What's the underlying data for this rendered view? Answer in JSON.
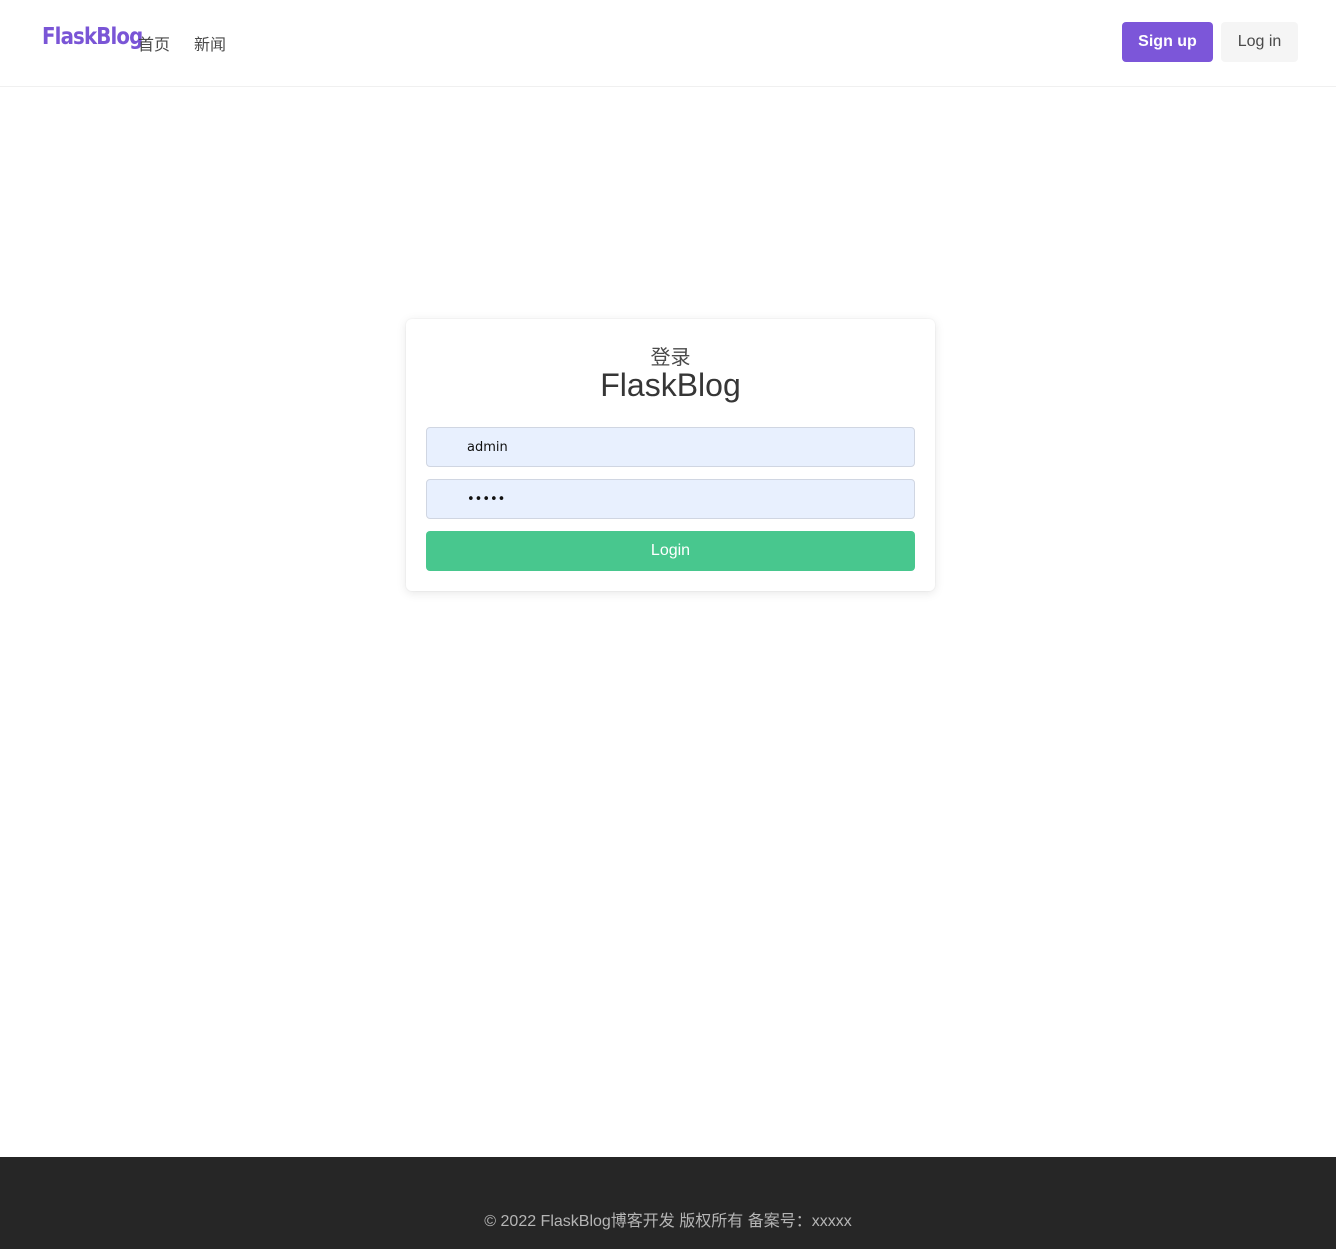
{
  "navbar": {
    "brand": "FlaskBlog",
    "links": [
      {
        "label": "首页"
      },
      {
        "label": "新闻"
      }
    ],
    "signup_label": "Sign up",
    "login_label": "Log in"
  },
  "login_card": {
    "subtitle": "登录",
    "title": "FlaskBlog",
    "username_value": "admin",
    "password_value": "•••••",
    "submit_label": "Login"
  },
  "footer": {
    "text": "© 2022 FlaskBlog博客开发 版权所有 备案号：xxxxx"
  },
  "colors": {
    "brand": "#7a55d6",
    "signup_bg": "#7c56d9",
    "submit_bg": "#48c78e",
    "input_bg": "#e8f0fe",
    "footer_bg": "#262626"
  }
}
